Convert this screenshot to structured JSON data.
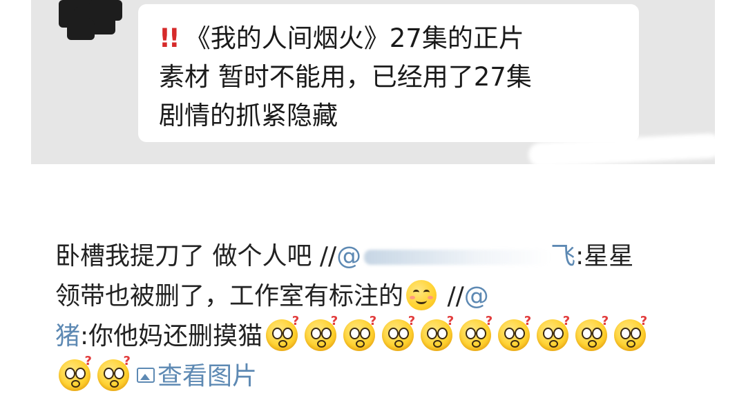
{
  "chat_screenshot": {
    "message_parts": [
      "《我的人间烟火》27集的正片",
      "素材 暂时不能用，已经用了27集",
      "剧情的抓紧隐藏"
    ],
    "alert_mark": "!!"
  },
  "post": {
    "line1_text": "卧槽我提刀了 做个人吧 //",
    "mention1_at": "@",
    "mention1_tail": "飞",
    "line1_after": ":星星",
    "line2_text": "领带也被删了，工作室有标注的",
    "line2_sep": " //",
    "mention2_at": "@",
    "line3_mention": "猪",
    "line3_text": ":你他妈还删摸猫",
    "view_image_label": "查看图片"
  },
  "icons": {
    "alert": "double-exclamation-icon",
    "smile": "smile-emoji-icon",
    "confused": "confused-emoji-icon",
    "picture": "picture-icon"
  },
  "colors": {
    "link": "#5d89b3",
    "alert": "#d62a2a",
    "text": "#222222"
  }
}
